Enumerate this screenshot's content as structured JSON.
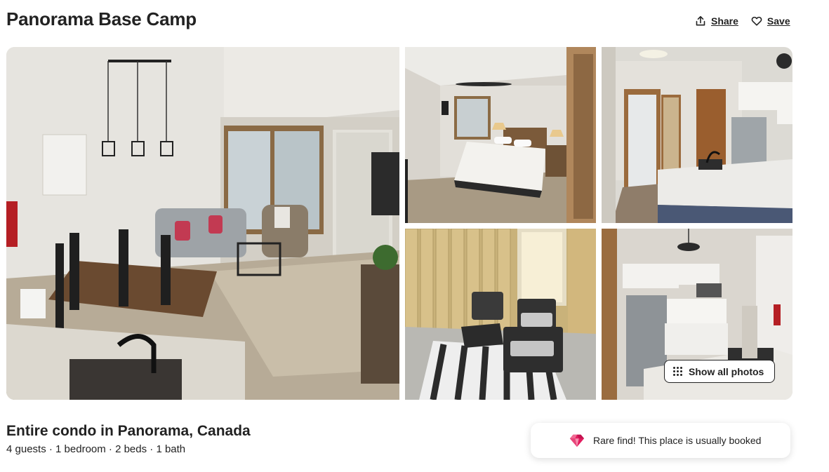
{
  "listing": {
    "title": "Panorama Base Camp",
    "subtitle": "Entire condo in Panorama, Canada",
    "details": "4 guests · 1 bedroom · 2 beds · 1 bath"
  },
  "actions": {
    "share_label": "Share",
    "save_label": "Save"
  },
  "gallery": {
    "show_all_label": "Show all photos",
    "photos": [
      "living-dining-room",
      "bedroom",
      "hallway-kitchen",
      "patio",
      "kitchen"
    ]
  },
  "banner": {
    "text": "Rare find! This place is usually booked",
    "icon": "diamond-icon",
    "icon_color": "#E31C5F"
  },
  "colors": {
    "text": "#222222",
    "background": "#FFFFFF"
  }
}
